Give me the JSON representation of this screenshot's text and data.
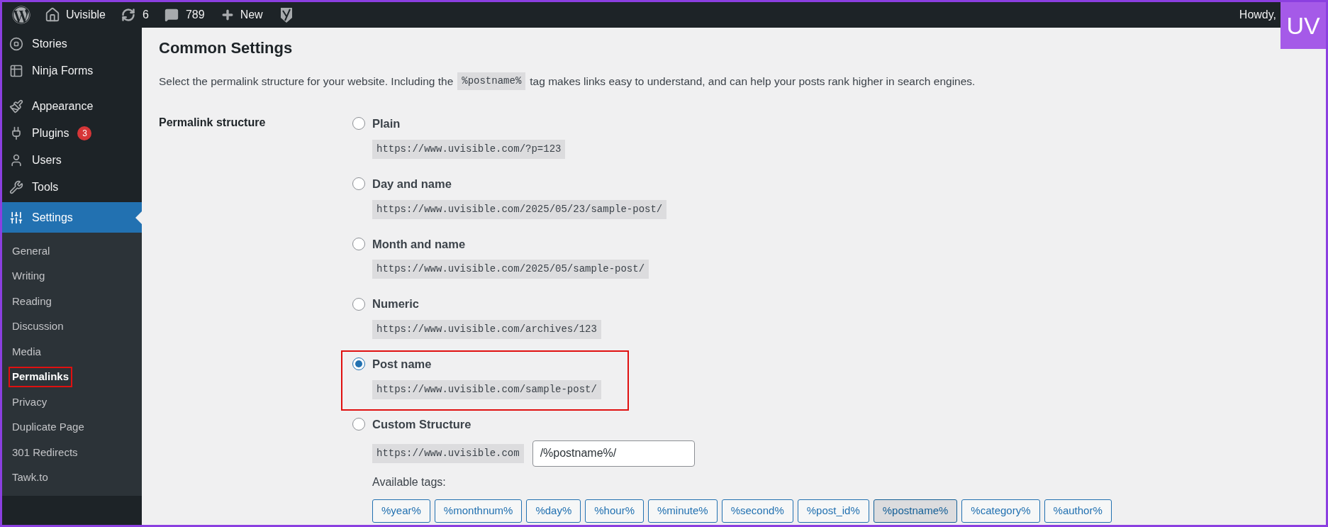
{
  "admin_bar": {
    "site_name": "Uvisible",
    "updates": "6",
    "comments": "789",
    "new_label": "New",
    "greeting": "Howdy,",
    "logo_text": "UV"
  },
  "sidebar": {
    "items": [
      {
        "label": "Stories",
        "selected": false
      },
      {
        "label": "Ninja Forms",
        "selected": false
      },
      {
        "label": "Appearance",
        "selected": false
      },
      {
        "label": "Plugins",
        "selected": false,
        "badge": "3"
      },
      {
        "label": "Users",
        "selected": false
      },
      {
        "label": "Tools",
        "selected": false
      },
      {
        "label": "Settings",
        "selected": true
      }
    ],
    "submenu": [
      {
        "label": "General",
        "selected": false,
        "highlighted": false
      },
      {
        "label": "Writing",
        "selected": false,
        "highlighted": false
      },
      {
        "label": "Reading",
        "selected": false,
        "highlighted": false
      },
      {
        "label": "Discussion",
        "selected": false,
        "highlighted": false
      },
      {
        "label": "Media",
        "selected": false,
        "highlighted": false
      },
      {
        "label": "Permalinks",
        "selected": true,
        "highlighted": true
      },
      {
        "label": "Privacy",
        "selected": false,
        "highlighted": false
      },
      {
        "label": "Duplicate Page",
        "selected": false,
        "highlighted": false
      },
      {
        "label": "301 Redirects",
        "selected": false,
        "highlighted": false
      },
      {
        "label": "Tawk.to",
        "selected": false,
        "highlighted": false
      }
    ]
  },
  "content": {
    "title": "Common Settings",
    "description": [
      {
        "kind": "text",
        "text": "Select the permalink structure for your website. Including the"
      },
      {
        "kind": "code",
        "text": "%postname%"
      },
      {
        "kind": "text",
        "text": "tag makes links easy to understand, and can help your posts rank higher in search engines."
      }
    ],
    "field_label": "Permalink structure",
    "options": [
      {
        "kind": "preset",
        "label": "Plain",
        "example": "https://www.uvisible.com/?p=123",
        "selected": false,
        "highlighted": false
      },
      {
        "kind": "preset",
        "label": "Day and name",
        "example": "https://www.uvisible.com/2025/05/23/sample-post/",
        "selected": false,
        "highlighted": false
      },
      {
        "kind": "preset",
        "label": "Month and name",
        "example": "https://www.uvisible.com/2025/05/sample-post/",
        "selected": false,
        "highlighted": false
      },
      {
        "kind": "preset",
        "label": "Numeric",
        "example": "https://www.uvisible.com/archives/123",
        "selected": false,
        "highlighted": false
      },
      {
        "kind": "preset",
        "label": "Post name",
        "example": "https://www.uvisible.com/sample-post/",
        "selected": true,
        "highlighted": true
      },
      {
        "kind": "custom",
        "label": "Custom Structure",
        "example": "https://www.uvisible.com",
        "value": "/%postname%/",
        "selected": false,
        "highlighted": false
      }
    ],
    "tags_label": "Available tags:",
    "tags": [
      {
        "label": "%year%",
        "selected": false
      },
      {
        "label": "%monthnum%",
        "selected": false
      },
      {
        "label": "%day%",
        "selected": false
      },
      {
        "label": "%hour%",
        "selected": false
      },
      {
        "label": "%minute%",
        "selected": false
      },
      {
        "label": "%second%",
        "selected": false
      },
      {
        "label": "%post_id%",
        "selected": false
      },
      {
        "label": "%postname%",
        "selected": true
      },
      {
        "label": "%category%",
        "selected": false
      },
      {
        "label": "%author%",
        "selected": false
      }
    ]
  }
}
